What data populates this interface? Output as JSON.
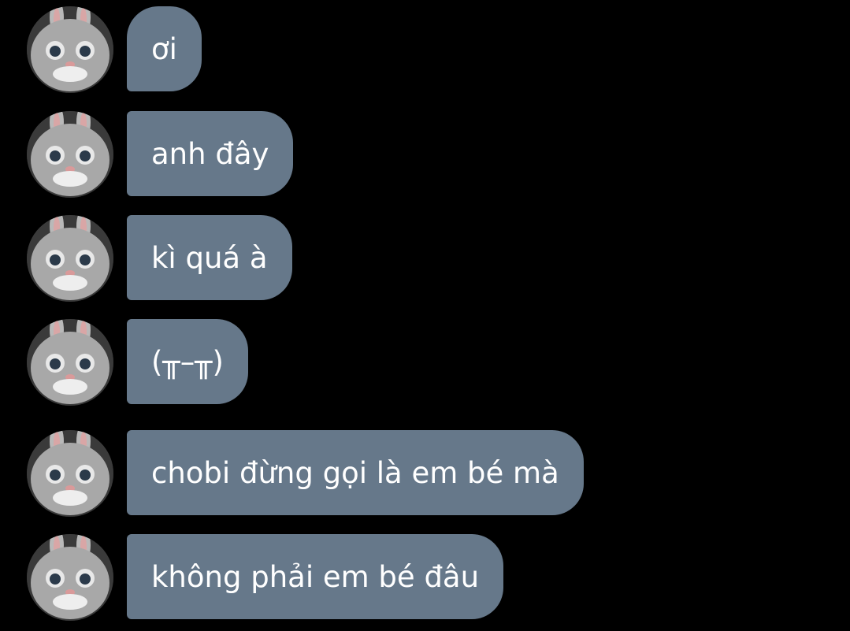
{
  "conversation": {
    "sender_avatar_icon": "bunny-mascot-avatar-icon",
    "bubble_color": "#66788a",
    "messages": [
      {
        "text": "ơi"
      },
      {
        "text": "anh đây"
      },
      {
        "text": "kì quá à"
      },
      {
        "text": "(╥–╥)"
      },
      {
        "text": "chobi đừng gọi là em bé mà"
      },
      {
        "text": "không phải em bé đâu"
      }
    ]
  }
}
